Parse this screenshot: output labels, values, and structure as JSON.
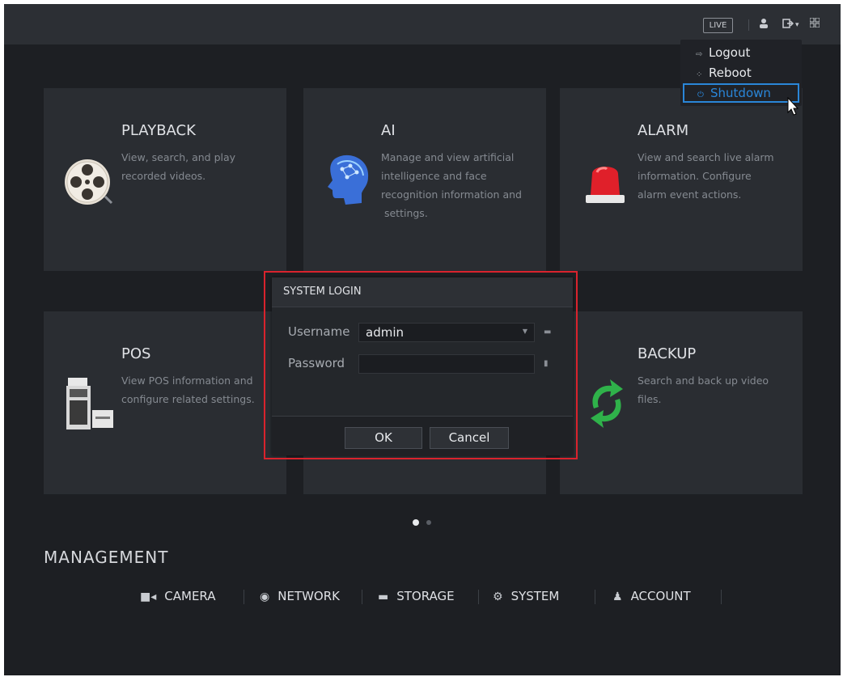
{
  "topbar": {
    "live_label": "LIVE",
    "icons": [
      "user-icon",
      "logout-icon",
      "chevron-down-icon",
      "grid-icon"
    ]
  },
  "user_menu": {
    "items": [
      {
        "label": "Logout",
        "icon": "logout-icon"
      },
      {
        "label": "Reboot",
        "icon": "reboot-icon"
      },
      {
        "label": "Shutdown",
        "icon": "power-icon"
      }
    ],
    "highlighted": "Shutdown",
    "highlight_color": "#2a86d8"
  },
  "tiles": [
    {
      "title": "PLAYBACK",
      "desc_lines": [
        "View, search, and play",
        "recorded videos."
      ],
      "icon": "film-reel-icon"
    },
    {
      "title": "AI",
      "desc_lines": [
        "Manage and view artificial",
        "intelligence and face",
        "recognition information and",
        " settings."
      ],
      "icon": "ai-head-icon"
    },
    {
      "title": "ALARM",
      "desc_lines": [
        "View and search live alarm",
        "information. Configure",
        "alarm event actions."
      ],
      "icon": "siren-icon"
    },
    {
      "title": "POS",
      "desc_lines": [
        "View POS information and",
        "configure related settings."
      ],
      "icon": "cash-register-icon"
    },
    {
      "title": "BACKUP",
      "desc_lines": [
        "Search and back up video",
        "files."
      ],
      "icon": "refresh-icon"
    }
  ],
  "login": {
    "title": "SYSTEM LOGIN",
    "username_label": "Username",
    "username_value": "admin",
    "password_label": "Password",
    "password_value": "",
    "ok_label": "OK",
    "cancel_label": "Cancel",
    "highlight_color": "#d9232d"
  },
  "pagination": {
    "pages": 2,
    "current": 1
  },
  "management": {
    "title": "MANAGEMENT",
    "items": [
      {
        "label": "CAMERA",
        "icon": "camera-icon"
      },
      {
        "label": "NETWORK",
        "icon": "network-icon"
      },
      {
        "label": "STORAGE",
        "icon": "storage-icon"
      },
      {
        "label": "SYSTEM",
        "icon": "gears-icon"
      },
      {
        "label": "ACCOUNT",
        "icon": "account-icon"
      }
    ]
  }
}
